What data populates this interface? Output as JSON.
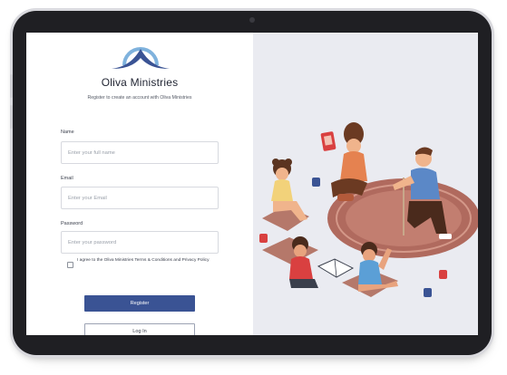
{
  "brand": {
    "name": "Oliva Ministries",
    "tagline": "Register to create an account with Oliva Ministries",
    "logo_color": "#3a5394",
    "logo_accent": "#7fb2dd"
  },
  "form": {
    "name_label": "Name",
    "name_placeholder": "Enter your full name",
    "email_label": "Email",
    "email_placeholder": "Enter your Email",
    "password_label": "Password",
    "password_placeholder": "Enter your password",
    "terms_text": "I agree to the Oliva Ministries Terms & Conditions and Privacy Policy",
    "register_label": "Register",
    "login_label": "Log In"
  },
  "illustration": {
    "description_icon": "family-storytime-illustration",
    "rug_color": "#b06a5e",
    "accent_color": "#d94040"
  }
}
